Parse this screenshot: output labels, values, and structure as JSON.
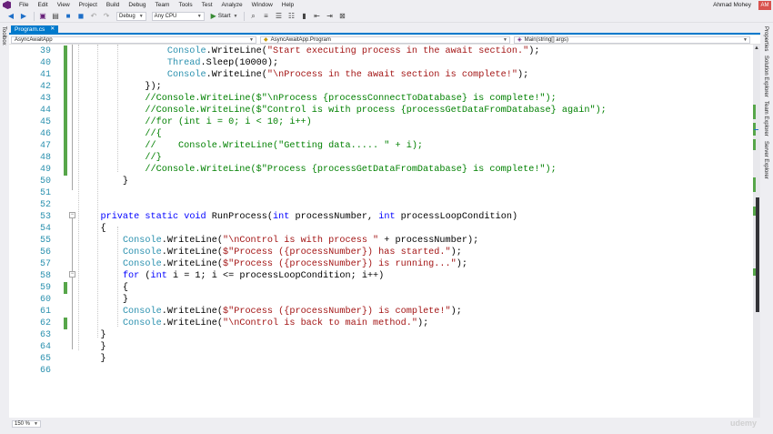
{
  "menubar": {
    "items": [
      "File",
      "Edit",
      "View",
      "Project",
      "Build",
      "Debug",
      "Team",
      "Tools",
      "Test",
      "Analyze",
      "Window",
      "Help"
    ],
    "account_name": "Ahmad Mohey",
    "avatar_initials": "AM"
  },
  "toolbar": {
    "config": "Debug",
    "platform": "Any CPU",
    "start_label": "Start"
  },
  "side_panels": {
    "left": [
      "Toolbox"
    ],
    "right": [
      "Properties",
      "Solution Explorer",
      "Team Explorer",
      "Server Explorer"
    ]
  },
  "tab": {
    "label": "Program.cs",
    "close": "✕"
  },
  "navbar": {
    "project": "AsyncAwaitApp",
    "class": "AsyncAwaitApp.Program",
    "member": "Main(string[] args)"
  },
  "editor": {
    "lines": [
      {
        "num": "39",
        "changed": true,
        "tokens": [
          [
            "pl",
            "        "
          ],
          [
            "ty",
            "Console"
          ],
          [
            "pl",
            "."
          ],
          [
            "pl",
            "WriteLine"
          ],
          [
            "pl",
            "("
          ],
          [
            "str",
            "\"Start executing process in the await section.\""
          ],
          [
            "pl",
            ");"
          ]
        ]
      },
      {
        "num": "40",
        "changed": true,
        "tokens": [
          [
            "pl",
            "        "
          ],
          [
            "ty",
            "Thread"
          ],
          [
            "pl",
            ".Sleep(10000);"
          ]
        ]
      },
      {
        "num": "41",
        "changed": true,
        "tokens": [
          [
            "pl",
            "        "
          ],
          [
            "ty",
            "Console"
          ],
          [
            "pl",
            ".WriteLine("
          ],
          [
            "str",
            "\"\\nProcess in the await section is complete!\""
          ],
          [
            "pl",
            ");"
          ]
        ]
      },
      {
        "num": "42",
        "changed": true,
        "tokens": [
          [
            "pl",
            "    });"
          ]
        ]
      },
      {
        "num": "43",
        "changed": true,
        "tokens": [
          [
            "cm",
            "    //Console.WriteLine($\"\\nProcess {processConnectToDatabase} is complete!\");"
          ]
        ]
      },
      {
        "num": "44",
        "changed": true,
        "tokens": [
          [
            "cm",
            "    //Console.WriteLine($\"Control is with process {processGetDataFromDatabase} again\");"
          ]
        ]
      },
      {
        "num": "45",
        "changed": true,
        "tokens": [
          [
            "cm",
            "    //for (int i = 0; i < 10; i++)"
          ]
        ]
      },
      {
        "num": "46",
        "changed": true,
        "tokens": [
          [
            "cm",
            "    //{"
          ]
        ]
      },
      {
        "num": "47",
        "changed": true,
        "tokens": [
          [
            "cm",
            "    //    Console.WriteLine(\"Getting data..... \" + i);"
          ]
        ]
      },
      {
        "num": "48",
        "changed": true,
        "tokens": [
          [
            "cm",
            "    //}"
          ]
        ]
      },
      {
        "num": "49",
        "changed": true,
        "tokens": [
          [
            "cm",
            "    //Console.WriteLine($\"Process {processGetDataFromDatabase} is complete!\");"
          ]
        ]
      },
      {
        "num": "50",
        "changed": false,
        "tokens": [
          [
            "pl",
            "}"
          ]
        ]
      },
      {
        "num": "51",
        "changed": false,
        "tokens": []
      },
      {
        "num": "52",
        "changed": false,
        "tokens": []
      },
      {
        "num": "53",
        "changed": false,
        "tokens": [
          [
            "kw",
            "private"
          ],
          [
            "pl",
            " "
          ],
          [
            "kw",
            "static"
          ],
          [
            "pl",
            " "
          ],
          [
            "kw",
            "void"
          ],
          [
            "pl",
            " RunProcess("
          ],
          [
            "kw",
            "int"
          ],
          [
            "pl",
            " processNumber, "
          ],
          [
            "kw",
            "int"
          ],
          [
            "pl",
            " processLoopCondition)"
          ]
        ]
      },
      {
        "num": "54",
        "changed": false,
        "tokens": [
          [
            "pl",
            "{"
          ]
        ]
      },
      {
        "num": "55",
        "changed": false,
        "tokens": [
          [
            "pl",
            "    "
          ],
          [
            "ty",
            "Console"
          ],
          [
            "pl",
            ".WriteLine("
          ],
          [
            "str",
            "\"\\nControl is with process \""
          ],
          [
            "pl",
            " + processNumber);"
          ]
        ]
      },
      {
        "num": "56",
        "changed": false,
        "tokens": [
          [
            "pl",
            "    "
          ],
          [
            "ty",
            "Console"
          ],
          [
            "pl",
            ".WriteLine("
          ],
          [
            "str",
            "$\"Process ({processNumber}) has started.\""
          ],
          [
            "pl",
            ");"
          ]
        ]
      },
      {
        "num": "57",
        "changed": false,
        "tokens": [
          [
            "pl",
            "    "
          ],
          [
            "ty",
            "Console"
          ],
          [
            "pl",
            ".WriteLine("
          ],
          [
            "str",
            "$\"Process ({processNumber}) is running...\""
          ],
          [
            "pl",
            ");"
          ]
        ]
      },
      {
        "num": "58",
        "changed": false,
        "tokens": [
          [
            "pl",
            "    "
          ],
          [
            "kw",
            "for"
          ],
          [
            "pl",
            " ("
          ],
          [
            "kw",
            "int"
          ],
          [
            "pl",
            " i = 1; i <= processLoopCondition; i++)"
          ]
        ]
      },
      {
        "num": "59",
        "changed": true,
        "tokens": [
          [
            "pl",
            "    {"
          ]
        ]
      },
      {
        "num": "60",
        "changed": false,
        "tokens": [
          [
            "pl",
            "    }"
          ]
        ]
      },
      {
        "num": "61",
        "changed": false,
        "tokens": [
          [
            "pl",
            "    "
          ],
          [
            "ty",
            "Console"
          ],
          [
            "pl",
            ".WriteLine("
          ],
          [
            "str",
            "$\"Process ({processNumber}) is complete!\""
          ],
          [
            "pl",
            ");"
          ]
        ]
      },
      {
        "num": "62",
        "changed": true,
        "tokens": [
          [
            "pl",
            "    "
          ],
          [
            "ty",
            "Console"
          ],
          [
            "pl",
            ".WriteLine("
          ],
          [
            "str",
            "\"\\nControl is back to main method.\""
          ],
          [
            "pl",
            ");"
          ]
        ]
      },
      {
        "num": "63",
        "changed": false,
        "tokens": [
          [
            "pl",
            "}"
          ]
        ]
      },
      {
        "num": "64",
        "changed": false,
        "tokens": [
          [
            "pl",
            "}"
          ]
        ]
      },
      {
        "num": "65",
        "changed": false,
        "tokens": [
          [
            "pl",
            "}"
          ]
        ]
      },
      {
        "num": "66",
        "changed": false,
        "tokens": []
      }
    ]
  },
  "statusbar": {
    "zoom": "150 %",
    "watermark": "udemy"
  },
  "colors": {
    "accent": "#007acc",
    "keyword": "#0000ff",
    "string": "#a31515",
    "comment": "#008000",
    "type": "#2b91af",
    "change_bar": "#57a64a"
  }
}
